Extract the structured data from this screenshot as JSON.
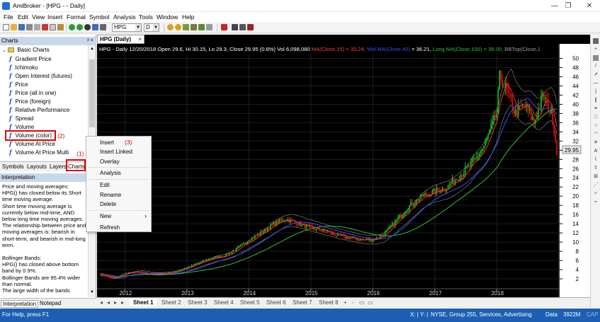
{
  "window": {
    "title": "AmiBroker - [HPG -  - Daily]",
    "controls": [
      "—",
      "❐",
      "✕"
    ]
  },
  "menu": [
    "File",
    "Edit",
    "View",
    "Insert",
    "Format",
    "Symbol",
    "Analysis",
    "Tools",
    "Window",
    "Help"
  ],
  "toolbar": {
    "symbol": "HPG",
    "interval": "D"
  },
  "charts_panel": {
    "header": "Charts",
    "pin": "ᵖ ×",
    "folder": "Basic Charts",
    "items": [
      "Gradient Price",
      "Ichimoku",
      "Open Interest (futures)",
      "Price",
      "Price (all in one)",
      "Price (foreign)",
      "Relative Performance",
      "Spread",
      "Volume",
      "Volume (color)",
      "Volume At Price",
      "Volume At Price Multi"
    ],
    "tabs": [
      "Symbols",
      "Layouts",
      "Layers",
      "Charts"
    ]
  },
  "annotations": {
    "a1": "(1)",
    "a2": "(2)",
    "a3": "(3)"
  },
  "interpretation": {
    "header": "Interpretation",
    "lines": [
      "Price and moving averages:",
      "HPG() has closed below its Short",
      "time moving average.",
      "Short time moving average is",
      "currently below mid-time, AND",
      "below long time moving averages.",
      "The relationship between price and",
      "moving averages is: bearish in",
      "short-term, and bearish in mid-long",
      "term.",
      "",
      "Bollinger Bands:",
      "HPG() has closed above bottom",
      "band by 0.9%.",
      "Bollinger Bands are 95.4% wider",
      "than normal.",
      "The large width of the bands"
    ],
    "tabs": [
      "Interpretation",
      "Notepad"
    ]
  },
  "context_menu": {
    "insert": "Insert",
    "insert_linked": "Insert Linked",
    "overlay": "Overlay",
    "analysis": "Analysis",
    "edit": "Edit",
    "rename": "Rename",
    "delete": "Delete",
    "new": "New",
    "new_arrow": "›",
    "refresh": "Refresh"
  },
  "chart_tab": {
    "label": "HPG (Daily)",
    "close": "×"
  },
  "chart_header": {
    "main": "HPG - Daily 12/20/2018 Open 29.6, Hi 30.15, Lo 29.3, Close 29.95 (0.8%) Vol 6,098,080",
    "ma_short": "MA(Close,15) = 33.24,",
    "ma_mid_label": "Mid MA(Close,45)",
    "ma_mid_value": "= 36.21,",
    "ma_long": "Long MA(Close,100) = 38.00,",
    "bb": "BBTop(Close,1"
  },
  "price_label": "29.95",
  "colors": {
    "bull": "#20c020",
    "bear": "#e01010",
    "ma_short": "#ff3030",
    "ma_mid": "#3050ff",
    "ma_long": "#30c030",
    "bb": "#8a8a8a",
    "status": "#1c5fb3"
  },
  "chart_data": {
    "type": "line",
    "y_ticks": [
      2,
      4,
      6,
      8,
      10,
      12,
      14,
      16,
      18,
      20,
      22,
      24,
      26,
      28,
      30,
      32,
      34,
      36,
      38,
      40,
      42,
      44,
      46,
      48,
      50
    ],
    "ylim": [
      0,
      51
    ],
    "x_ticks": [
      "2012",
      "2013",
      "2014",
      "2015",
      "2016",
      "2017",
      "2018"
    ],
    "series": [
      {
        "name": "HPG",
        "x": [
          2011.6,
          2011.8,
          2012.0,
          2012.2,
          2012.4,
          2012.6,
          2012.8,
          2013.0,
          2013.2,
          2013.4,
          2013.6,
          2013.8,
          2014.0,
          2014.2,
          2014.4,
          2014.6,
          2014.8,
          2015.0,
          2015.2,
          2015.4,
          2015.6,
          2015.8,
          2016.0,
          2016.2,
          2016.4,
          2016.6,
          2016.8,
          2017.0,
          2017.2,
          2017.4,
          2017.6,
          2017.8,
          2018.0,
          2018.05,
          2018.15,
          2018.3,
          2018.45,
          2018.6,
          2018.75,
          2018.9,
          2018.97
        ],
        "values": [
          3.0,
          2.0,
          3.2,
          3.5,
          3.0,
          3.2,
          3.5,
          4.5,
          5.5,
          6.5,
          7.0,
          8.5,
          10.5,
          12.0,
          14.0,
          15.0,
          14.0,
          13.0,
          12.5,
          11.5,
          11.0,
          10.5,
          10.5,
          12.0,
          15.0,
          18.0,
          20.0,
          21.0,
          22.0,
          24.5,
          27.0,
          31.0,
          38.0,
          46.5,
          43.0,
          38.0,
          40.0,
          36.0,
          42.0,
          37.0,
          30.0
        ]
      }
    ]
  },
  "sheets": [
    "Sheet 1",
    "Sheet 2",
    "Sheet 3",
    "Sheet 4",
    "Sheet 5",
    "Sheet 6",
    "Sheet 7",
    "Sheet 8"
  ],
  "sheet_nav": [
    "◂",
    "◂",
    "▸",
    "▸"
  ],
  "sheet_controls": [
    "+",
    "-",
    "▭",
    "▭"
  ],
  "status": {
    "help": "For Help, press F1",
    "xy": "X: | Y: |",
    "market": "NYSE, Group 255, Services, Advertising",
    "data": "Data",
    "memory": "3922M",
    "cap": "CAP"
  }
}
